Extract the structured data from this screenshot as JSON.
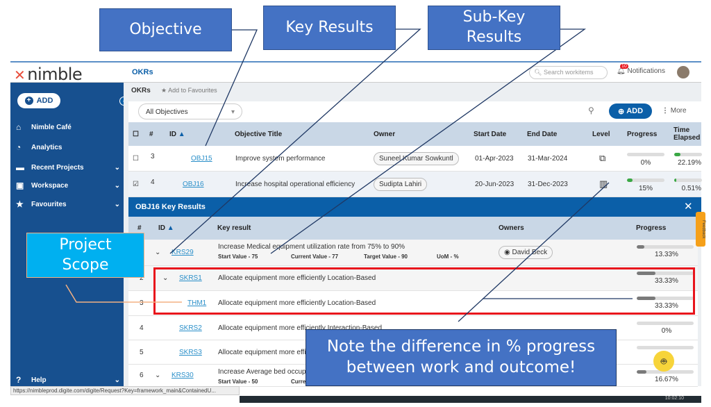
{
  "header": {
    "logo": "nimble",
    "title": "OKRs",
    "search_placeholder": "Search workitems",
    "notif_count": "10",
    "notifications": "Notifications"
  },
  "sidebar": {
    "add": "ADD",
    "items": [
      {
        "label": "Nimble Café",
        "icon": "home-icon"
      },
      {
        "label": "Analytics",
        "icon": "gauge-icon"
      },
      {
        "label": "Recent Projects",
        "icon": "briefcase-icon"
      },
      {
        "label": "Workspace",
        "icon": "monitor-icon"
      },
      {
        "label": "Favourites",
        "icon": "star-icon"
      }
    ],
    "help": "Help"
  },
  "breadcrumb": {
    "page": "OKRs",
    "fav": "Add to Favourites"
  },
  "toolbar": {
    "filter": "All Objectives",
    "add": "ADD",
    "more": "More"
  },
  "objectives": {
    "columns": [
      "#",
      "ID",
      "Objective Title",
      "Owner",
      "Start Date",
      "End Date",
      "Level",
      "Progress",
      "Time Elapsed"
    ],
    "rows": [
      {
        "num": "3",
        "id": "OBJ15",
        "title": "Improve system performance",
        "owner": "Suneel Kumar Sowkuntl",
        "start": "01-Apr-2023",
        "end": "31-Mar-2024",
        "progress": "0%",
        "progress_value": 0,
        "elapsed": "22.19%",
        "elapsed_value": 22.19,
        "checked": false
      },
      {
        "num": "4",
        "id": "OBJ16",
        "title": "Increase hospital operational efficiency",
        "owner": "Sudipta Lahiri",
        "start": "20-Jun-2023",
        "end": "31-Dec-2023",
        "progress": "15%",
        "progress_value": 15,
        "elapsed": "0.51%",
        "elapsed_value": 0.51,
        "checked": true
      }
    ]
  },
  "panel": {
    "title": "OBJ16 Key Results",
    "columns": [
      "#",
      "ID",
      "Key result",
      "Owners",
      "Progress"
    ],
    "rows": [
      {
        "num": "1",
        "id": "KRS29",
        "text": "Increase Medical equipment utilization rate from 75% to 90%",
        "meta": [
          "Start Value - 75",
          "Current Value - 77",
          "Target Value - 90",
          "UoM - %"
        ],
        "owner": "David Beck",
        "progress": "13.33%",
        "value": 13.33,
        "expand": true,
        "indent": 0
      },
      {
        "num": "2",
        "id": "SKRS1",
        "text": "Allocate equipment more efficiently Location-Based",
        "progress": "33.33%",
        "value": 33.33,
        "expand": true,
        "indent": 1
      },
      {
        "num": "3",
        "id": "THM1",
        "text": "Allocate equipment more efficiently Location-Based",
        "progress": "33.33%",
        "value": 33.33,
        "expand": false,
        "indent": 2
      },
      {
        "num": "4",
        "id": "SKRS2",
        "text": "Allocate equipment more efficiently Interaction-Based",
        "progress": "0%",
        "value": 0,
        "expand": false,
        "indent": 1
      },
      {
        "num": "5",
        "id": "SKRS3",
        "text": "Allocate equipment more efficiently",
        "progress": "",
        "value": 0,
        "expand": false,
        "indent": 1
      },
      {
        "num": "6",
        "id": "KRS30",
        "text": "Increase Average bed occupancy",
        "meta": [
          "Start Value - 50",
          "Current Value"
        ],
        "progress": "16.67%",
        "value": 16.67,
        "expand": true,
        "indent": 0
      }
    ]
  },
  "feedback": "Feedback",
  "status_url": "https://nimbleprod.digite.com/digite/Request?Key=framework_main&ContainedU...",
  "clock": "10:02:10",
  "callouts": {
    "objective": "Objective",
    "key_results": "Key Results",
    "sub_key_results": "Sub-Key Results",
    "project_scope": "Project Scope",
    "note": "Note the difference in % progress between work and outcome!"
  },
  "colors": {
    "sidebar": "#17508f",
    "panel_header": "#0b5fa8",
    "callout": "#4472c4",
    "scope": "#00b0f0",
    "highlight": "#e8141c"
  }
}
